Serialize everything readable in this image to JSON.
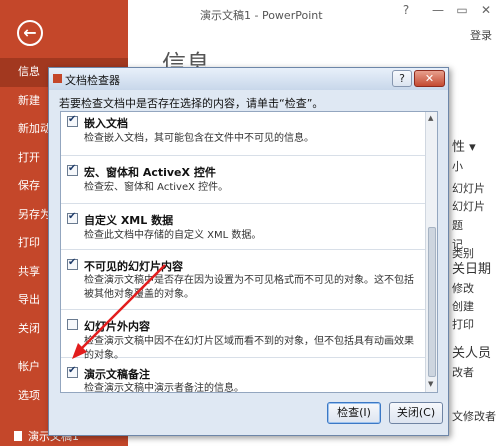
{
  "window": {
    "title": "演示文稿1 - PowerPoint",
    "help": "?",
    "minimize": "—",
    "restore": "▭",
    "close": "✕",
    "login": "登录"
  },
  "sidebar": {
    "back": "←",
    "items": [
      {
        "label": "信息"
      },
      {
        "label": "新建"
      },
      {
        "label": "新加动"
      },
      {
        "label": "打开"
      },
      {
        "label": "保存"
      },
      {
        "label": "另存为"
      },
      {
        "label": "打印"
      },
      {
        "label": "共享"
      },
      {
        "label": "导出"
      },
      {
        "label": "关闭"
      },
      {
        "label": "帐户"
      },
      {
        "label": "选项"
      }
    ],
    "recent_file": "演示文稿1"
  },
  "backstage": {
    "heading": "信息",
    "right_texts": [
      "性 ▾",
      "小",
      "幻灯片",
      "幻灯片",
      "题",
      "记",
      "类别",
      "关日期",
      "修改",
      "创建",
      "打印",
      "关人员",
      "改者"
    ],
    "right_texts_2": [
      "文修改者"
    ]
  },
  "dialog": {
    "title": "文档检查器",
    "help_label": "?",
    "close_label": "✕",
    "instruction": "若要检查文档中是否存在选择的内容，请单击“检查”。",
    "items": [
      {
        "title": "嵌入文档",
        "desc": "检查嵌入文档，其可能包含在文件中不可见的信息。",
        "checked": true
      },
      {
        "title": "宏、窗体和 ActiveX 控件",
        "desc": "检查宏、窗体和 ActiveX 控件。",
        "checked": true
      },
      {
        "title": "自定义 XML 数据",
        "desc": "检查此文档中存储的自定义 XML 数据。",
        "checked": true
      },
      {
        "title": "不可见的幻灯片内容",
        "desc": "检查演示文稿中是否存在因为设置为不可见格式而不可见的对象。这不包括被其他对象覆盖的对象。",
        "checked": true
      },
      {
        "title": "幻灯片外内容",
        "desc": "检查演示文稿中因不在幻灯片区域而看不到的对象，但不包括具有动画效果的对象。",
        "checked": false
      },
      {
        "title": "演示文稿备注",
        "desc": "检查演示文稿中演示者备注的信息。",
        "checked": true
      }
    ],
    "buttons": {
      "inspect": "检查(I)",
      "close": "关闭(C)"
    }
  },
  "colors": {
    "sidebar": "#c4472a",
    "annotation_arrow": "#e21d1d"
  }
}
